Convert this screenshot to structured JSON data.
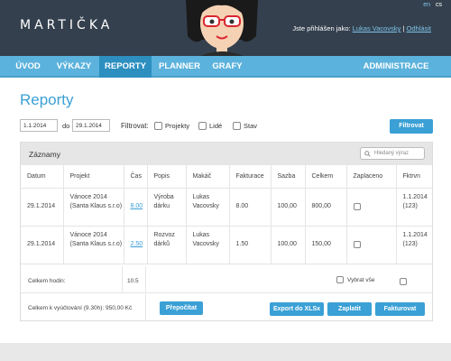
{
  "header": {
    "logo": "MARTIČKA",
    "languages": [
      "en",
      "cs"
    ],
    "login_prefix": "Jste přihlášen jako:",
    "user": "Lukas Vacovsky",
    "separator": "|",
    "logout": "Odhlásit"
  },
  "nav": {
    "items": [
      "ÚVOD",
      "VÝKAZY",
      "REPORTY",
      "PLANNER",
      "GRAFY"
    ],
    "admin": "ADMINISTRACE",
    "active": "REPORTY"
  },
  "page_title": "Reporty",
  "filter": {
    "date_from": "1.1.2014",
    "to_label": "do",
    "date_to": "29.1.2014",
    "filter_label": "Filtrovat:",
    "options": [
      "Projekty",
      "Lidé",
      "Stav"
    ],
    "button": "Filtrovat"
  },
  "records": {
    "title": "Záznamy",
    "search_placeholder": "Hledaný výraz",
    "columns": [
      "Datum",
      "Projekt",
      "Čas",
      "Popis",
      "Makáč",
      "Fakturace",
      "Sazba",
      "Celkem",
      "Zaplaceno",
      "Fktrvn"
    ],
    "rows": [
      {
        "datum": "29.1.2014",
        "projekt": "Vánoce 2014 (Santa Klaus s.r.o)",
        "cas": "8.00",
        "popis": "Výroba dárku",
        "makac": "Lukas Vacovsky",
        "fakturace": "8.00",
        "sazba": "100,00",
        "celkem": "800,00",
        "zaplaceno": false,
        "fktrvn": "1.1.2014 (123)"
      },
      {
        "datum": "29.1.2014",
        "projekt": "Vánoce 2014 (Santa Klaus s.r.o)",
        "cas": "2.50",
        "popis": "Rozvoz dárků",
        "makac": "Lukas Vacovsky",
        "fakturace": "1.50",
        "sazba": "100,00",
        "celkem": "150,00",
        "zaplaceno": false,
        "fktrvn": "1.1.2014 (123)"
      }
    ],
    "total_hours_label": "Celkem hodin:",
    "total_hours": "10.5",
    "select_all": "Vybrat vše",
    "billing_label": "Celkem k vyúčtování (9.30h): 950,00 Kč",
    "buttons": {
      "recalc": "Přepočítat",
      "export": "Export do XLSx",
      "pay": "Zaplatit",
      "invoice": "Fakturovat"
    }
  },
  "colors": {
    "header_bg": "#34404e",
    "nav_bg": "#5bb2dc",
    "nav_active": "#2c8fc0",
    "accent": "#3aa0d5"
  }
}
